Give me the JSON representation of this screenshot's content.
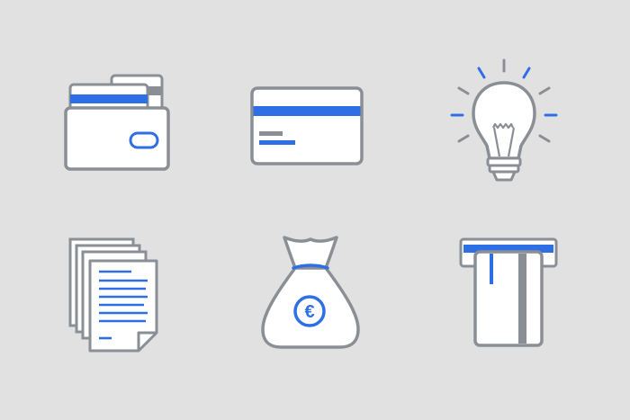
{
  "colors": {
    "background": "#e1e1e1",
    "stroke": "#8a8f96",
    "accent": "#2f6fe6",
    "fill": "#ffffff"
  },
  "icons": [
    {
      "name": "wallet-icon"
    },
    {
      "name": "credit-card-icon"
    },
    {
      "name": "light-bulb-icon"
    },
    {
      "name": "documents-icon"
    },
    {
      "name": "money-bag-icon",
      "symbol": "€"
    },
    {
      "name": "atm-card-slot-icon"
    }
  ]
}
